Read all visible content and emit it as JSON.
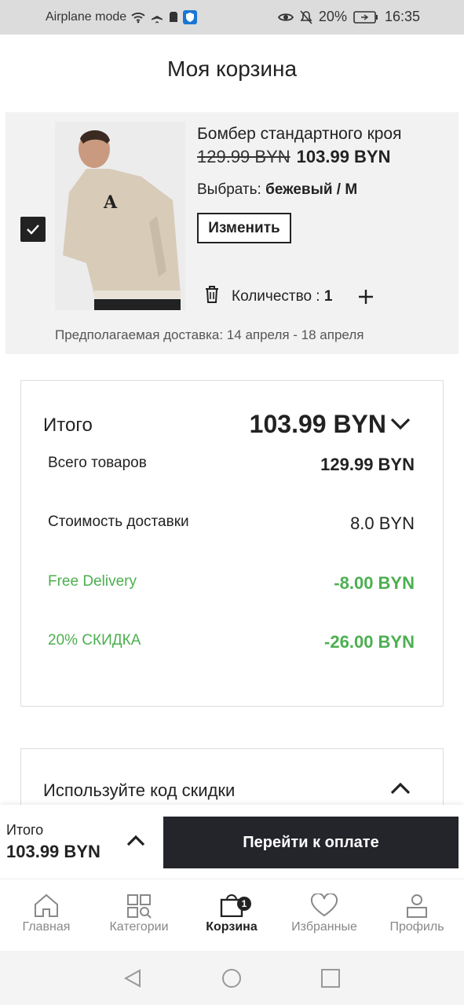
{
  "status_bar": {
    "left_text": "Airplane mode",
    "battery": "20%",
    "time": "16:35"
  },
  "page": {
    "title": "Моя корзина"
  },
  "cart_item": {
    "name": "Бомбер стандартного кроя",
    "old_price": "129.99 BYN",
    "new_price": "103.99 BYN",
    "option_label": "Выбрать:",
    "option_value": "бежевый / M",
    "edit_label": "Изменить",
    "quantity_label": "Количество :",
    "quantity_value": "1",
    "delivery_estimate": "Предполагаемая доставка: 14 апреля - 18 апреля",
    "selected": true
  },
  "summary": {
    "total_label": "Итого",
    "total_value": "103.99 BYN",
    "rows": [
      {
        "label": "Всего товаров",
        "value": "129.99 BYN",
        "color": "#222222"
      },
      {
        "label": "Стоимость доставки",
        "value": "8.0 BYN",
        "color": "#222222"
      },
      {
        "label": "Free Delivery",
        "value": "-8.00 BYN",
        "color": "#4caf50"
      },
      {
        "label": "20% СКИДКА",
        "value": "-26.00 BYN",
        "color": "#4caf50"
      }
    ]
  },
  "promo": {
    "label": "Используйте код скидки"
  },
  "bottom_bar": {
    "total_label": "Итого",
    "total_value": "103.99 BYN",
    "checkout_label": "Перейти к оплате"
  },
  "tabs": [
    {
      "label": "Главная",
      "icon": "home-icon"
    },
    {
      "label": "Категории",
      "icon": "categories-icon"
    },
    {
      "label": "Корзина",
      "icon": "cart-icon",
      "badge": "1",
      "active": true
    },
    {
      "label": "Избранные",
      "icon": "heart-icon"
    },
    {
      "label": "Профиль",
      "icon": "profile-icon"
    }
  ],
  "colors": {
    "accent_dark": "#24242b",
    "discount_green": "#4caf50"
  }
}
